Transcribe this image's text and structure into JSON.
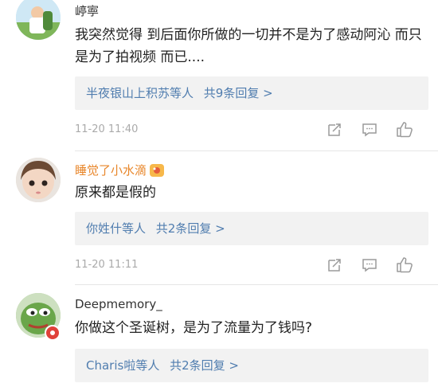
{
  "comments": [
    {
      "name": "嵉寕",
      "text": "我突然觉得 到后面你所做的一切并不是为了感动阿沁 而只是为了拍视频 而已....",
      "reply_who": "半夜银山上积苏等人",
      "reply_count": "共9条回复 >",
      "time": "11-20 11:40"
    },
    {
      "name": "睡觉了小水滴",
      "text": "原来都是假的",
      "reply_who": "你姓什等人",
      "reply_count": "共2条回复 >",
      "time": "11-20 11:11"
    },
    {
      "name": "Deepmemory_",
      "text": "你做这个圣诞树，是为了流量为了钱吗?",
      "reply_who": "Charis啦等人",
      "reply_count": "共2条回复 >"
    }
  ],
  "icons": [
    "share-icon",
    "comment-icon",
    "like-icon",
    "vip-badge-icon"
  ],
  "colors": {
    "link": "#507daf",
    "orange_name": "#e8862a",
    "meta": "#aaaaaa",
    "reply_bg": "#f2f2f2"
  }
}
